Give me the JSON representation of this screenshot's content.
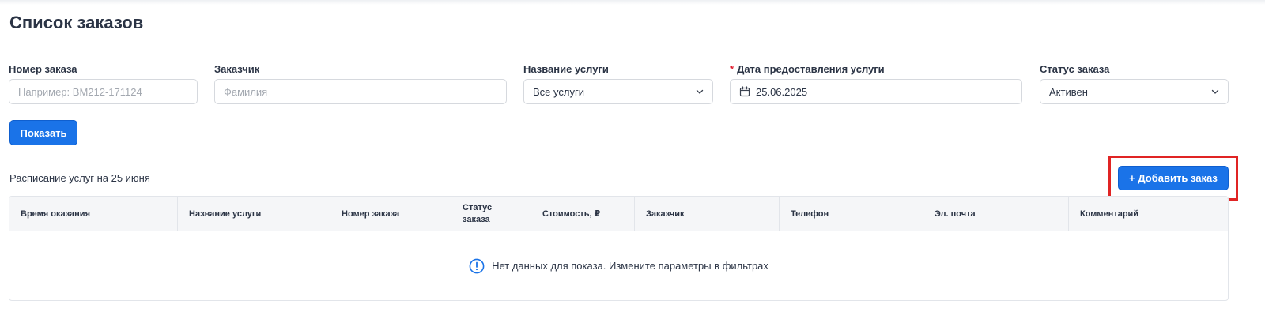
{
  "page": {
    "title": "Список заказов"
  },
  "filters": {
    "order_number": {
      "label": "Номер заказа",
      "placeholder": "Например: BM212-171124"
    },
    "customer": {
      "label": "Заказчик",
      "placeholder": "Фамилия"
    },
    "service_name": {
      "label": "Название услуги",
      "value": "Все услуги"
    },
    "service_date": {
      "label": "Дата предоставления услуги",
      "required_mark": "*",
      "value": "25.06.2025",
      "icon": "calendar-icon"
    },
    "order_status": {
      "label": "Статус заказа",
      "value": "Активен"
    }
  },
  "actions": {
    "show_label": "Показать",
    "add_order_label": "+ Добавить заказ"
  },
  "schedule": {
    "label": "Расписание услуг на 25 июня"
  },
  "table": {
    "columns": [
      "Время оказания",
      "Название услуги",
      "Номер заказа",
      "Статус заказа",
      "Стоимость, ₽",
      "Заказчик",
      "Телефон",
      "Эл. почта",
      "Комментарий"
    ],
    "empty_message": "Нет данных для показа. Измените параметры в фильтрах"
  },
  "colors": {
    "primary": "#1a73e8",
    "highlight": "#e02424",
    "required": "#e11d2e"
  }
}
